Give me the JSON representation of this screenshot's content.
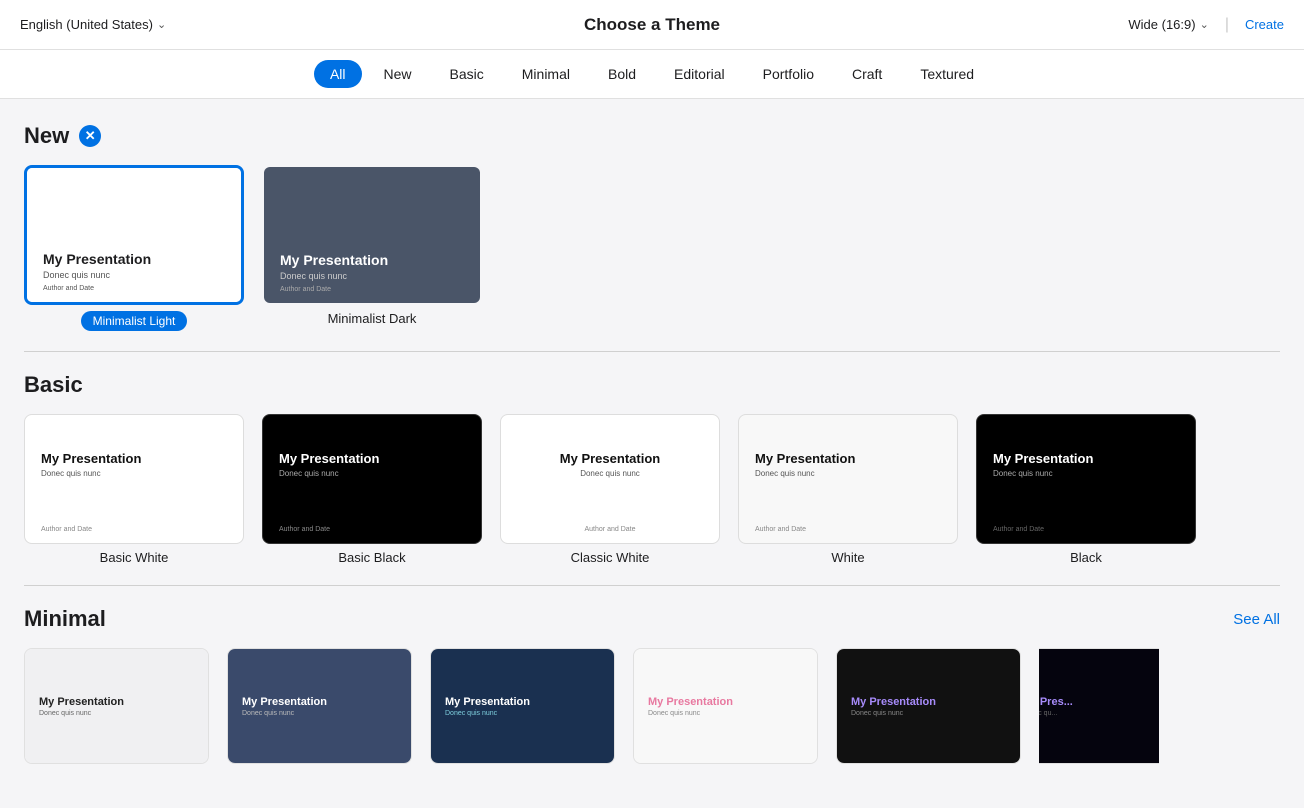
{
  "header": {
    "language_label": "English (United States)",
    "title": "Choose a Theme",
    "aspect_ratio": "Wide (16:9)",
    "create_label": "Create"
  },
  "tabs": [
    {
      "id": "all",
      "label": "All",
      "active": true
    },
    {
      "id": "new",
      "label": "New",
      "active": false
    },
    {
      "id": "basic",
      "label": "Basic",
      "active": false
    },
    {
      "id": "minimal",
      "label": "Minimal",
      "active": false
    },
    {
      "id": "bold",
      "label": "Bold",
      "active": false
    },
    {
      "id": "editorial",
      "label": "Editorial",
      "active": false
    },
    {
      "id": "portfolio",
      "label": "Portfolio",
      "active": false
    },
    {
      "id": "craft",
      "label": "Craft",
      "active": false
    },
    {
      "id": "textured",
      "label": "Textured",
      "active": false
    }
  ],
  "sections": {
    "new": {
      "title": "New",
      "themes": [
        {
          "name": "Minimalist Light",
          "selected": true,
          "bg": "white",
          "text_color": "dark",
          "title_text": "My Presentation",
          "subtitle_text": "Donec quis nunc",
          "author_text": "Author and Date"
        },
        {
          "name": "Minimalist Dark",
          "selected": false,
          "bg": "dark-slate",
          "text_color": "light",
          "title_text": "My Presentation",
          "subtitle_text": "Donec quis nunc",
          "author_text": "Author and Date"
        }
      ]
    },
    "basic": {
      "title": "Basic",
      "themes": [
        {
          "name": "Basic White",
          "bg": "white",
          "text_color": "dark",
          "title_text": "My Presentation",
          "subtitle_text": "Donec quis nunc",
          "author_text": "Author and Date"
        },
        {
          "name": "Basic Black",
          "bg": "black",
          "text_color": "light",
          "title_text": "My Presentation",
          "subtitle_text": "Donec quis nunc",
          "author_text": "Author and Date"
        },
        {
          "name": "Classic White",
          "bg": "classic-white",
          "text_color": "dark",
          "title_text": "My Presentation",
          "subtitle_text": "Donec quis nunc",
          "author_text": "Author and Date"
        },
        {
          "name": "White",
          "bg": "light-gray",
          "text_color": "dark",
          "title_text": "My Presentation",
          "subtitle_text": "Donec quis nunc",
          "author_text": "Author and Date"
        },
        {
          "name": "Black",
          "bg": "black",
          "text_color": "light",
          "title_text": "My Presentation",
          "subtitle_text": "Donec quis nunc",
          "author_text": "Author and Date"
        }
      ]
    },
    "minimal": {
      "title": "Minimal",
      "see_all": "See All",
      "themes": [
        {
          "name": "",
          "bg": "minimal-1",
          "text_color": "dark",
          "title_text": "My Presentation",
          "subtitle_text": "Donec quis nunc"
        },
        {
          "name": "",
          "bg": "minimal-2",
          "text_color": "light",
          "title_text": "My Presentation",
          "subtitle_text": "Donec quis nunc"
        },
        {
          "name": "",
          "bg": "minimal-3",
          "text_color": "light",
          "title_text": "My Presentation",
          "subtitle_text": "Donec quis nunc",
          "accent": "cyan"
        },
        {
          "name": "",
          "bg": "minimal-4",
          "text_color": "dark",
          "title_text": "My Presentation",
          "subtitle_text": "Donec quis nunc",
          "accent": "pink"
        },
        {
          "name": "",
          "bg": "minimal-5",
          "text_color": "light",
          "title_text": "My Presentation",
          "subtitle_text": "Donec quis nunc",
          "accent": "purple"
        },
        {
          "name": "",
          "bg": "minimal-6",
          "text_color": "light",
          "title_text": "My Pres...",
          "subtitle_text": "Donec qu...",
          "accent": "purple",
          "partial": true
        }
      ]
    }
  }
}
